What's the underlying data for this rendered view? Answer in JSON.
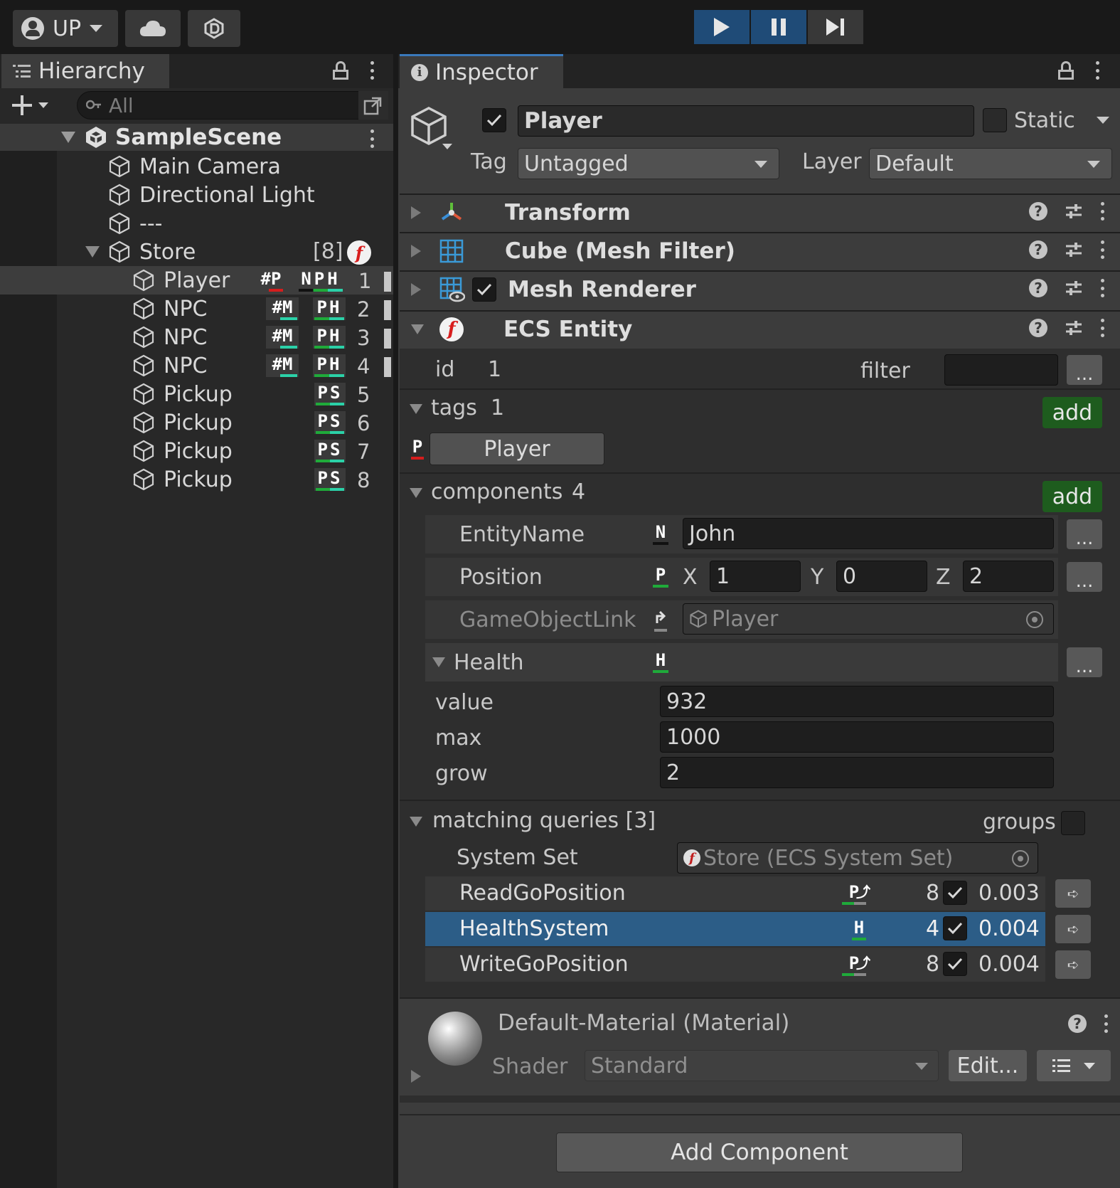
{
  "toolbar": {
    "account_label": "UP",
    "play_color": "#1f4b77"
  },
  "hierarchy": {
    "tab_label": "Hierarchy",
    "search_placeholder": "All",
    "scene": "SampleScene",
    "items": [
      {
        "name": "Main Camera"
      },
      {
        "name": "Directional Light"
      },
      {
        "name": "---"
      },
      {
        "name": "Store",
        "count": "[8]"
      },
      {
        "name": "Player",
        "hash": "#P",
        "tags": "NPH",
        "id": "1"
      },
      {
        "name": "NPC",
        "hash": "#M",
        "tags": "PH",
        "id": "2"
      },
      {
        "name": "NPC",
        "hash": "#M",
        "tags": "PH",
        "id": "3"
      },
      {
        "name": "NPC",
        "hash": "#M",
        "tags": "PH",
        "id": "4"
      },
      {
        "name": "Pickup",
        "tags": "PS",
        "id": "5"
      },
      {
        "name": "Pickup",
        "tags": "PS",
        "id": "6"
      },
      {
        "name": "Pickup",
        "tags": "PS",
        "id": "7"
      },
      {
        "name": "Pickup",
        "tags": "PS",
        "id": "8"
      }
    ]
  },
  "inspector": {
    "tab_label": "Inspector",
    "object_name": "Player",
    "static_label": "Static",
    "tag_label": "Tag",
    "tag_value": "Untagged",
    "layer_label": "Layer",
    "layer_value": "Default",
    "components": [
      "Transform",
      "Cube (Mesh Filter)",
      "Mesh Renderer",
      "ECS Entity"
    ],
    "ecs": {
      "id_label": "id",
      "id_value": "1",
      "filter_label": "filter",
      "more": "...",
      "tags_label": "tags",
      "tags_count": "1",
      "add_label": "add",
      "tag_badge": "P",
      "tag_name": "Player",
      "components_label": "components",
      "components_count": "4",
      "entity_name_label": "EntityName",
      "entity_name_badge": "N",
      "entity_name_value": "John",
      "position_label": "Position",
      "position_badge": "P",
      "x_label": "X",
      "x_value": "1",
      "y_label": "Y",
      "y_value": "0",
      "z_label": "Z",
      "z_value": "2",
      "golink_label": "GameObjectLink",
      "golink_value": "Player",
      "health_label": "Health",
      "health_badge": "H",
      "value_label": "value",
      "value_value": "932",
      "max_label": "max",
      "max_value": "1000",
      "grow_label": "grow",
      "grow_value": "2",
      "matching_label": "matching queries [3]",
      "groups_label": "groups",
      "system_set_label": "System Set",
      "system_set_value": "Store (ECS System Set)",
      "queries": [
        {
          "name": "ReadGoPosition",
          "badge": "P",
          "count": "8",
          "time": "0.003"
        },
        {
          "name": "HealthSystem",
          "badge": "H",
          "count": "4",
          "time": "0.004"
        },
        {
          "name": "WriteGoPosition",
          "badge": "P",
          "count": "8",
          "time": "0.004"
        }
      ]
    },
    "material": {
      "title": "Default-Material (Material)",
      "shader_label": "Shader",
      "shader_value": "Standard",
      "edit_label": "Edit..."
    },
    "add_component_label": "Add Component"
  }
}
